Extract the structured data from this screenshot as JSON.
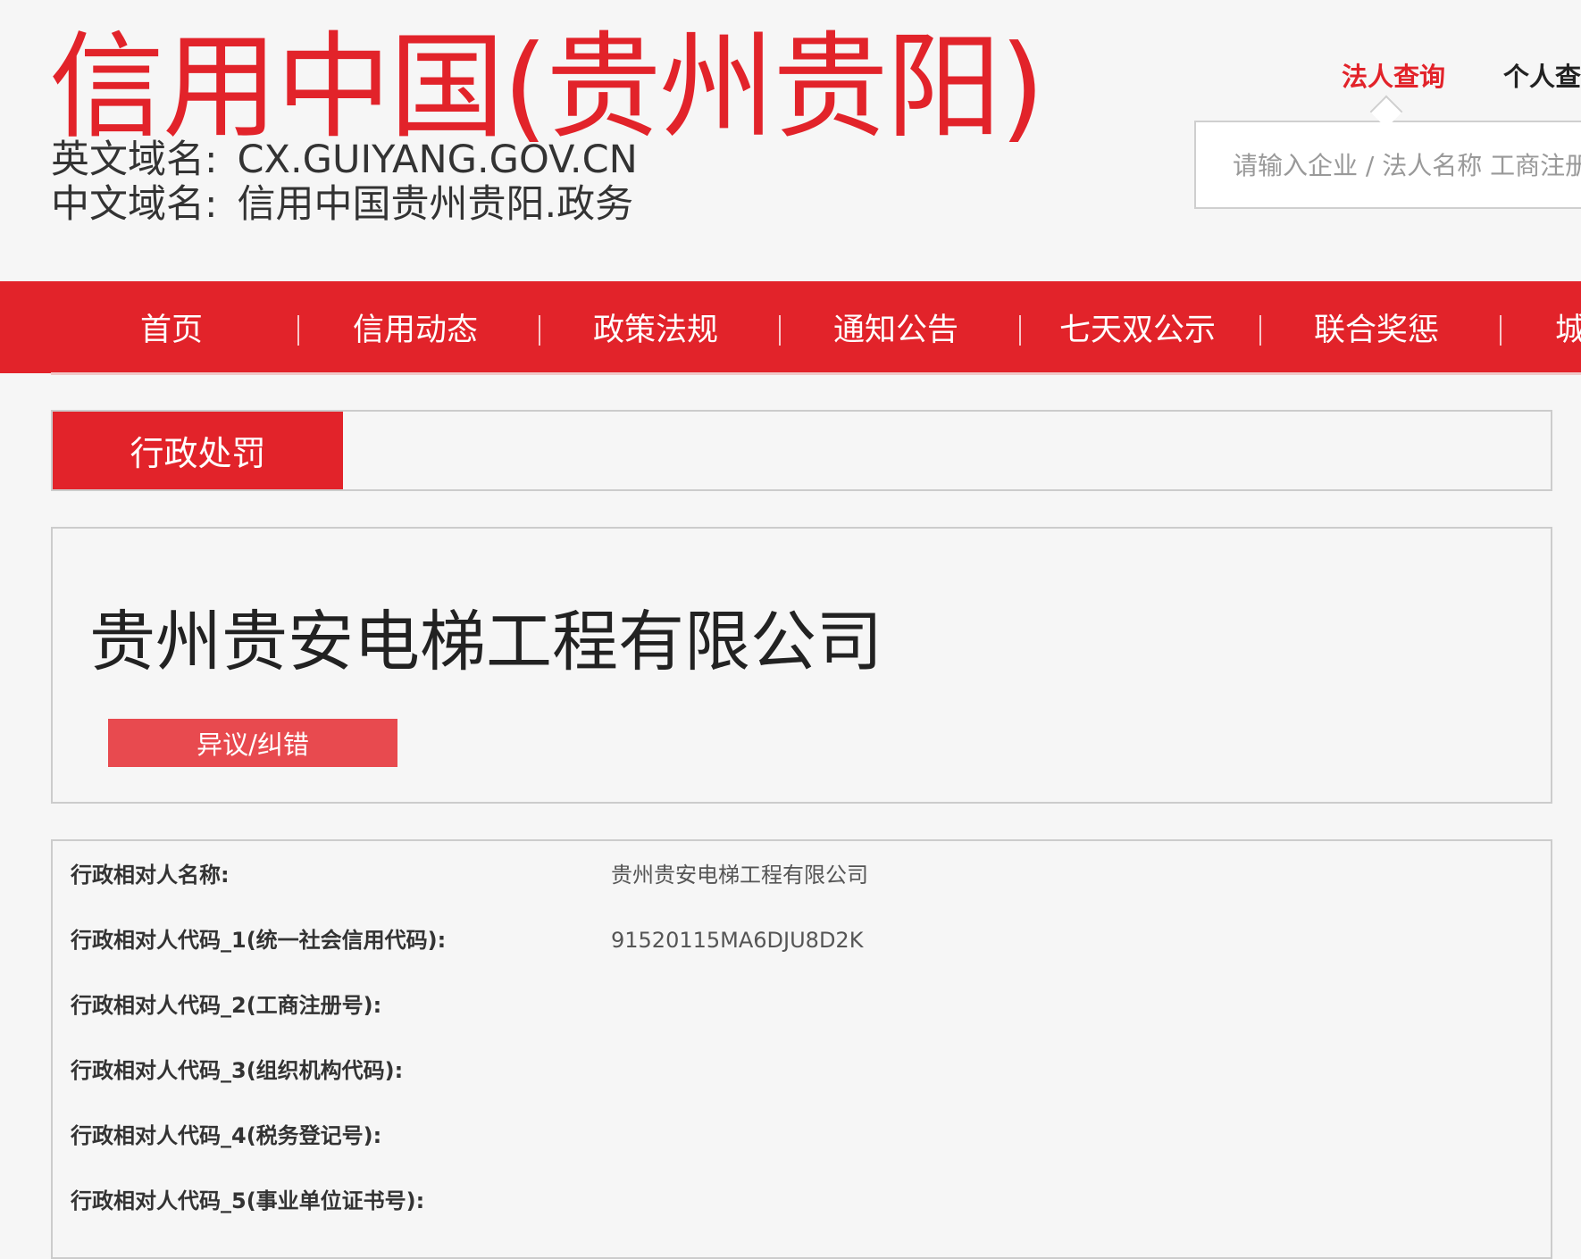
{
  "colors": {
    "brand_red": "#e2232a",
    "button_red": "#e84a4f",
    "page_bg": "#f6f6f6",
    "text_dark": "#222222"
  },
  "header": {
    "site_title": "信用中国(贵州贵阳)",
    "english_domain_label": "英文域名:",
    "english_domain_value": "CX.GUIYANG.GOV.CN",
    "chinese_domain_label": "中文域名:",
    "chinese_domain_value": "信用中国贵州贵阳.政务"
  },
  "search": {
    "tabs": [
      {
        "label": "法人查询",
        "active": true
      },
      {
        "label": "个人查询",
        "active": false
      }
    ],
    "placeholder": "请输入企业 / 法人名称 工商注册号"
  },
  "nav": {
    "items": [
      {
        "label": "首页"
      },
      {
        "label": "信用动态"
      },
      {
        "label": "政策法规"
      },
      {
        "label": "通知公告"
      },
      {
        "label": "七天双公示"
      },
      {
        "label": "联合奖惩"
      },
      {
        "label": "城市"
      }
    ]
  },
  "section": {
    "tab_label": "行政处罚"
  },
  "company": {
    "name": "贵州贵安电梯工程有限公司",
    "dispute_button": "异议/纠错"
  },
  "details": {
    "rows": [
      {
        "label": "行政相对人名称:",
        "value": "贵州贵安电梯工程有限公司"
      },
      {
        "label": "行政相对人代码_1(统一社会信用代码):",
        "value": "91520115MA6DJU8D2K"
      },
      {
        "label": "行政相对人代码_2(工商注册号):",
        "value": ""
      },
      {
        "label": "行政相对人代码_3(组织机构代码):",
        "value": ""
      },
      {
        "label": "行政相对人代码_4(税务登记号):",
        "value": ""
      },
      {
        "label": "行政相对人代码_5(事业单位证书号):",
        "value": ""
      }
    ]
  }
}
